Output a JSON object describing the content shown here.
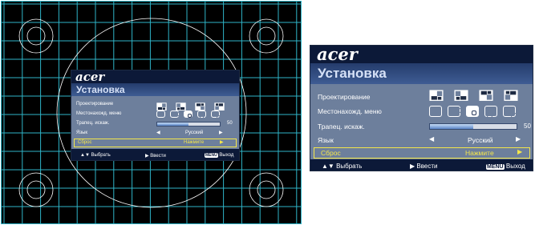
{
  "brand": {
    "logo_text": "acer"
  },
  "osd": {
    "title": "Установка",
    "rows": [
      {
        "id": "projection",
        "label": "Проектирование"
      },
      {
        "id": "menu_location",
        "label": "Местонахожд. меню"
      },
      {
        "id": "keystone",
        "label": "Трапец. искаж.",
        "value": "50",
        "level": 0.5
      },
      {
        "id": "language",
        "label": "Язык",
        "value": "Русский"
      },
      {
        "id": "reset",
        "label": "Сброс",
        "value": "Нажмите",
        "selected": true
      }
    ],
    "hints": {
      "select": "Выбрать",
      "enter": "Ввести",
      "menu_key": "MENU",
      "exit": "Выход"
    },
    "projection_icons": [
      "front-desk-icon",
      "rear-desk-icon",
      "front-ceiling-icon",
      "rear-ceiling-icon"
    ],
    "location_icons": [
      "top-left-icon",
      "top-right-icon",
      "center-icon",
      "bottom-left-icon",
      "bottom-right-icon"
    ],
    "selected_location_index": 2
  },
  "colors": {
    "panel": "#6d7f9c",
    "header": "#0c1938",
    "highlight": "#f4e64a",
    "grid": "#2fb5c8"
  }
}
